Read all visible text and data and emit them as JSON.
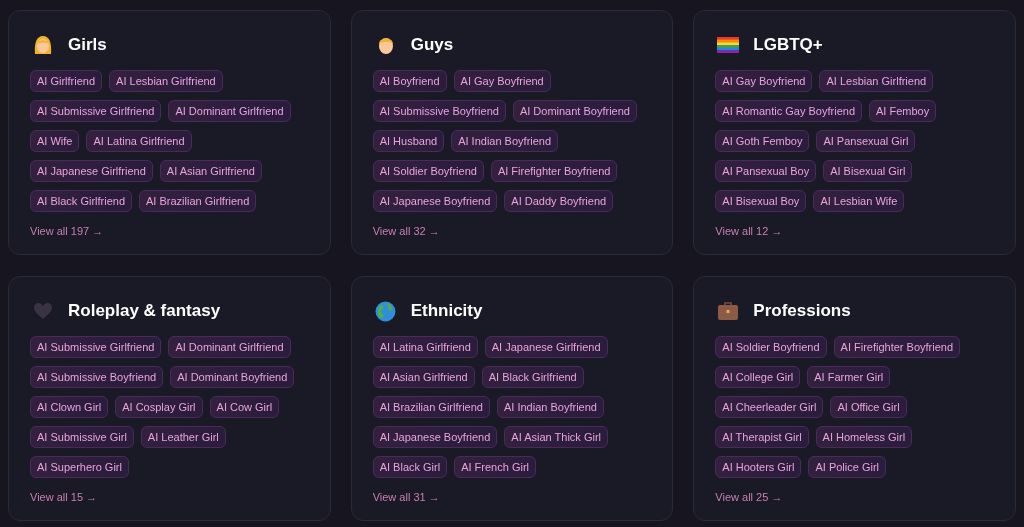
{
  "categories": [
    {
      "title": "Girls",
      "tags": [
        "AI Girlfriend",
        "AI Lesbian Girlfriend",
        "AI Submissive Girlfriend",
        "AI Dominant Girlfriend",
        "AI Wife",
        "AI Latina Girlfriend",
        "AI Japanese Girlfriend",
        "AI Asian Girlfriend",
        "AI Black Girlfriend",
        "AI Brazilian Girlfriend"
      ],
      "view_all": "View all 197 →"
    },
    {
      "title": "Guys",
      "tags": [
        "AI Boyfriend",
        "AI Gay Boyfriend",
        "AI Submissive Boyfriend",
        "AI Dominant Boyfriend",
        "AI Husband",
        "AI Indian Boyfriend",
        "AI Soldier Boyfriend",
        "AI Firefighter Boyfriend",
        "AI Japanese Boyfriend",
        "AI Daddy Boyfriend"
      ],
      "view_all": "View all 32 →"
    },
    {
      "title": "LGBTQ+",
      "tags": [
        "AI Gay Boyfriend",
        "AI Lesbian Girlfriend",
        "AI Romantic Gay Boyfriend",
        "AI Femboy",
        "AI Goth Femboy",
        "AI Pansexual Girl",
        "AI Pansexual Boy",
        "AI Bisexual Girl",
        "AI Bisexual Boy",
        "AI Lesbian Wife"
      ],
      "view_all": "View all 12 →"
    },
    {
      "title": "Roleplay & fantasy",
      "tags": [
        "AI Submissive Girlfriend",
        "AI Dominant Girlfriend",
        "AI Submissive Boyfriend",
        "AI Dominant Boyfriend",
        "AI Clown Girl",
        "AI Cosplay Girl",
        "AI Cow Girl",
        "AI Submissive Girl",
        "AI Leather Girl",
        "AI Superhero Girl"
      ],
      "view_all": "View all 15 →"
    },
    {
      "title": "Ethnicity",
      "tags": [
        "AI Latina Girlfriend",
        "AI Japanese Girlfriend",
        "AI Asian Girlfriend",
        "AI Black Girlfriend",
        "AI Brazilian Girlfriend",
        "AI Indian Boyfriend",
        "AI Japanese Boyfriend",
        "AI Asian Thick Girl",
        "AI Black Girl",
        "AI French Girl"
      ],
      "view_all": "View all 31 →"
    },
    {
      "title": "Professions",
      "tags": [
        "AI Soldier Boyfriend",
        "AI Firefighter Boyfriend",
        "AI College Girl",
        "AI Farmer Girl",
        "AI Cheerleader Girl",
        "AI Office Girl",
        "AI Therapist Girl",
        "AI Homeless Girl",
        "AI Hooters Girl",
        "AI Police Girl"
      ],
      "view_all": "View all 25 →"
    }
  ]
}
